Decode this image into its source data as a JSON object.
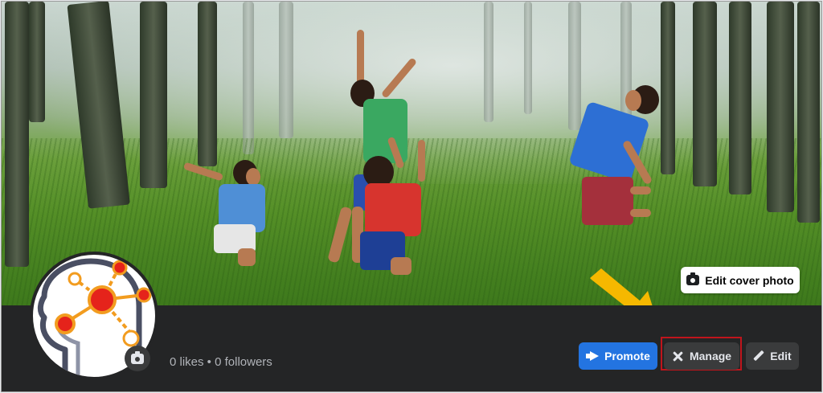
{
  "cover": {
    "edit_cover_label": "Edit cover photo"
  },
  "profile": {
    "stats": "0 likes • 0 followers"
  },
  "actions": {
    "promote_label": "Promote",
    "manage_label": "Manage",
    "edit_label": "Edit"
  },
  "colors": {
    "accent": "#2374e1",
    "highlight": "#c0151c",
    "arrow": "#f5b800",
    "bar_bg": "#242526",
    "button_bg": "#3a3b3c"
  },
  "icons": [
    "camera-icon",
    "megaphone-icon",
    "tools-icon",
    "pencil-icon",
    "brain-network-icon",
    "arrow-icon"
  ]
}
